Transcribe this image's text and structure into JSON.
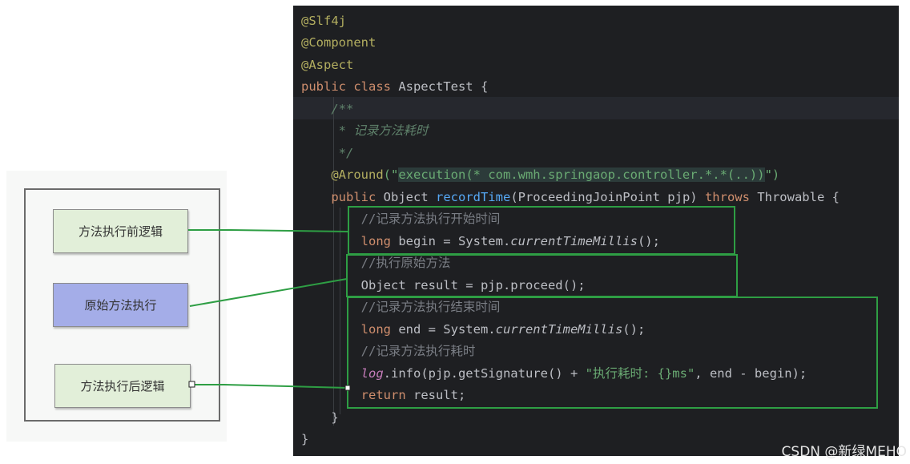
{
  "diagram": {
    "boxes": {
      "before": "方法执行前逻辑",
      "proceed": "原始方法执行",
      "after": "方法执行后逻辑"
    },
    "colors": {
      "step_box": "#e2efd9",
      "proceed_box": "#a4ade8",
      "connector": "#2e9e44"
    }
  },
  "editor": {
    "theme_background": "#1e1f22",
    "lines": {
      "l1": "@Slf4j",
      "l2": "@Component",
      "l3": "@Aspect",
      "l4_kw": "public class",
      "l4_name": " AspectTest {",
      "l5": "    /**",
      "l6": "     * 记录方法耗时",
      "l7": "     */",
      "l8_ann": "    @Around",
      "l8_open": "(\"",
      "l8_expr": "execution(* com.wmh.springaop.controller.*.*(..))",
      "l8_close": "\")",
      "l9_kw1": "    public",
      "l9_type": " Object ",
      "l9_fn": "recordTime",
      "l9_params": "(ProceedingJoinPoint pjp) ",
      "l9_kw2": "throws",
      "l9_rest": " Throwable {",
      "l10": "        //记录方法执行开始时间",
      "l11_kw": "        long",
      "l11_a": " begin = System.",
      "l11_call": "currentTimeMillis",
      "l11_b": "();",
      "l12": "        //执行原始方法",
      "l13": "        Object result = pjp.proceed();",
      "l14": "        //记录方法执行结束时间",
      "l15_kw": "        long",
      "l15_a": " end = System.",
      "l15_call": "currentTimeMillis",
      "l15_b": "();",
      "l16": "        //记录方法执行耗时",
      "l17_field": "        log",
      "l17_a": ".info(pjp.getSignature() + ",
      "l17_str": "\"执行耗时: {}ms\"",
      "l17_b": ", end - begin);",
      "l18_kw": "        return",
      "l18_rest": " result;",
      "l19": "    }",
      "l20": "}"
    }
  },
  "watermark": "CSDN @新绿MEHO"
}
